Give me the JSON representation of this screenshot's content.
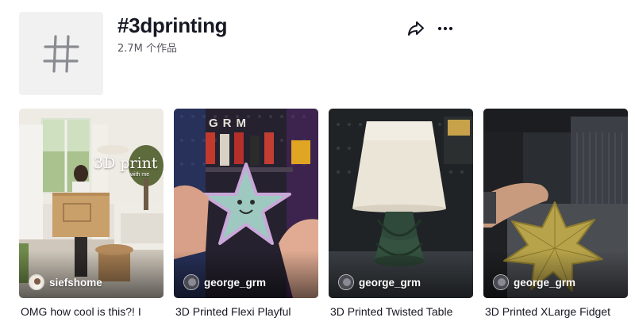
{
  "header": {
    "title": "#3dprinting",
    "count": "2.7M",
    "count_suffix": "个作品"
  },
  "videos": [
    {
      "author": "siefshome",
      "caption": "OMG how cool is this?! I",
      "overlay_text": "3D print",
      "overlay_sub": "with me"
    },
    {
      "author": "george_grm",
      "caption": "3D Printed Flexi Playful",
      "overlay_text": "GRM"
    },
    {
      "author": "george_grm",
      "caption": "3D Printed Twisted Table"
    },
    {
      "author": "george_grm",
      "caption": "3D Printed XLarge Fidget"
    }
  ],
  "colors": {
    "title": "#161823",
    "secondary_text": "#57585f",
    "avatar_bg": "#f1f1f2",
    "hash_glyph": "#8a8b91"
  },
  "icons": {
    "hashtag": "hashtag-icon",
    "share": "share-icon",
    "more": "more-icon"
  }
}
